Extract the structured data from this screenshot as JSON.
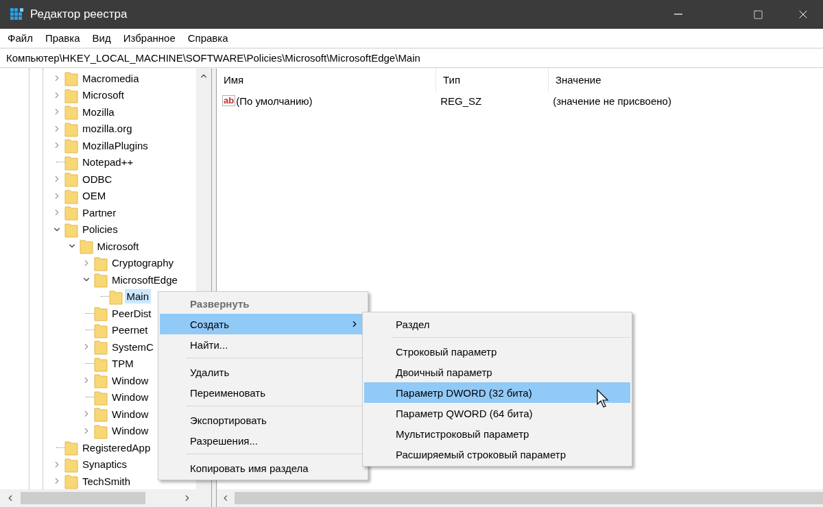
{
  "window": {
    "title": "Редактор реестра"
  },
  "menu": [
    "Файл",
    "Правка",
    "Вид",
    "Избранное",
    "Справка"
  ],
  "address": "Компьютер\\HKEY_LOCAL_MACHINE\\SOFTWARE\\Policies\\Microsoft\\MicrosoftEdge\\Main",
  "tree": {
    "items": [
      {
        "label": "Macromedia",
        "expandable": true,
        "expanded": false,
        "selected": false
      },
      {
        "label": "Microsoft",
        "expandable": true,
        "expanded": false,
        "selected": false
      },
      {
        "label": "Mozilla",
        "expandable": true,
        "expanded": false,
        "selected": false
      },
      {
        "label": "mozilla.org",
        "expandable": true,
        "expanded": false,
        "selected": false
      },
      {
        "label": "MozillaPlugins",
        "expandable": true,
        "expanded": false,
        "selected": false
      },
      {
        "label": "Notepad++",
        "expandable": false,
        "selected": false
      },
      {
        "label": "ODBC",
        "expandable": true,
        "expanded": false,
        "selected": false
      },
      {
        "label": "OEM",
        "expandable": true,
        "expanded": false,
        "selected": false
      },
      {
        "label": "Partner",
        "expandable": true,
        "expanded": false,
        "selected": false
      },
      {
        "label": "Policies",
        "expandable": true,
        "expanded": true,
        "selected": false,
        "children": [
          {
            "label": "Microsoft",
            "expandable": true,
            "expanded": true,
            "selected": false,
            "children": [
              {
                "label": "Cryptography",
                "expandable": true,
                "expanded": false,
                "selected": false
              },
              {
                "label": "MicrosoftEdge",
                "expandable": true,
                "expanded": true,
                "selected": false,
                "children": [
                  {
                    "label": "Main",
                    "expandable": false,
                    "selected": true
                  }
                ]
              },
              {
                "label": "PeerDist",
                "expandable": false,
                "selected": false
              },
              {
                "label": "Peernet",
                "expandable": false,
                "selected": false
              },
              {
                "label": "SystemC",
                "expandable": true,
                "expanded": false,
                "selected": false
              },
              {
                "label": "TPM",
                "expandable": false,
                "selected": false
              },
              {
                "label": "Window",
                "expandable": true,
                "expanded": false,
                "selected": false
              },
              {
                "label": "Window",
                "expandable": false,
                "selected": false
              },
              {
                "label": "Window",
                "expandable": true,
                "expanded": false,
                "selected": false
              },
              {
                "label": "Window",
                "expandable": true,
                "expanded": false,
                "selected": false
              }
            ]
          }
        ]
      },
      {
        "label": "RegisteredApp",
        "expandable": false,
        "selected": false
      },
      {
        "label": "Synaptics",
        "expandable": true,
        "expanded": false,
        "selected": false
      },
      {
        "label": "TechSmith",
        "expandable": true,
        "expanded": false,
        "selected": false
      }
    ]
  },
  "values": {
    "columns": [
      "Имя",
      "Тип",
      "Значение"
    ],
    "rows": [
      {
        "kind": "string",
        "icon": "ab",
        "name": "(По умолчанию)",
        "type": "REG_SZ",
        "data": "(значение не присвоено)"
      }
    ]
  },
  "context_menu": {
    "items": [
      {
        "kind": "item",
        "label": "Развернуть",
        "disabled": true,
        "default": true,
        "selected": false,
        "submenu": false
      },
      {
        "kind": "item",
        "label": "Создать",
        "disabled": false,
        "default": false,
        "selected": true,
        "submenu": true
      },
      {
        "kind": "item",
        "label": "Найти...",
        "disabled": false,
        "default": false,
        "selected": false,
        "submenu": false
      },
      {
        "kind": "separator"
      },
      {
        "kind": "item",
        "label": "Удалить",
        "disabled": false,
        "default": false,
        "selected": false,
        "submenu": false
      },
      {
        "kind": "item",
        "label": "Переименовать",
        "disabled": false,
        "default": false,
        "selected": false,
        "submenu": false
      },
      {
        "kind": "separator"
      },
      {
        "kind": "item",
        "label": "Экспортировать",
        "disabled": false,
        "default": false,
        "selected": false,
        "submenu": false
      },
      {
        "kind": "item",
        "label": "Разрешения...",
        "disabled": false,
        "default": false,
        "selected": false,
        "submenu": false
      },
      {
        "kind": "separator"
      },
      {
        "kind": "item",
        "label": "Копировать имя раздела",
        "disabled": false,
        "default": false,
        "selected": false,
        "submenu": false
      }
    ]
  },
  "submenu": {
    "items": [
      {
        "kind": "item",
        "label": "Раздел",
        "disabled": false,
        "default": false,
        "selected": false,
        "submenu": false
      },
      {
        "kind": "separator"
      },
      {
        "kind": "item",
        "label": "Строковый параметр",
        "disabled": false,
        "default": false,
        "selected": false,
        "submenu": false
      },
      {
        "kind": "item",
        "label": "Двоичный параметр",
        "disabled": false,
        "default": false,
        "selected": false,
        "submenu": false
      },
      {
        "kind": "item",
        "label": "Параметр DWORD (32 бита)",
        "disabled": false,
        "default": false,
        "selected": true,
        "submenu": false
      },
      {
        "kind": "item",
        "label": "Параметр QWORD (64 бита)",
        "disabled": false,
        "default": false,
        "selected": false,
        "submenu": false
      },
      {
        "kind": "item",
        "label": "Мультистроковый параметр",
        "disabled": false,
        "default": false,
        "selected": false,
        "submenu": false
      },
      {
        "kind": "item",
        "label": "Расширяемый строковый параметр",
        "disabled": false,
        "default": false,
        "selected": false,
        "submenu": false
      }
    ]
  }
}
